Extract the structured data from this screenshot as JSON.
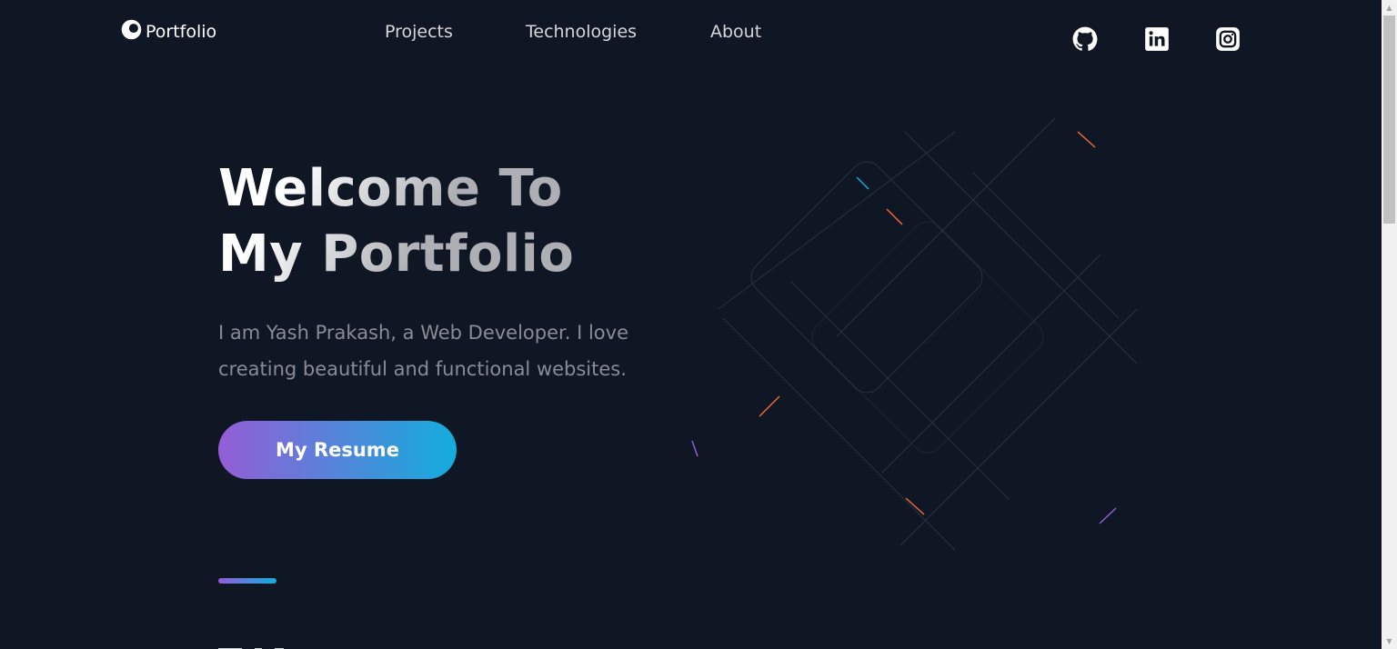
{
  "nav": {
    "logo_text": "Portfolio",
    "links": [
      {
        "label": "Projects"
      },
      {
        "label": "Technologies"
      },
      {
        "label": "About"
      }
    ],
    "social": [
      {
        "icon": "github-icon"
      },
      {
        "icon": "linkedin-icon"
      },
      {
        "icon": "instagram-icon"
      }
    ]
  },
  "hero": {
    "title_line1": "Welcome To",
    "title_line2": "My Portfolio",
    "description": "I am Yash Prakash, a Web Developer. I love creating beautiful and functional websites.",
    "button_label": "My Resume"
  },
  "colors": {
    "background": "#0f1624",
    "gradient_start": "#945dd6",
    "gradient_end": "#13addd",
    "nav_text": "#d6d6d9"
  }
}
